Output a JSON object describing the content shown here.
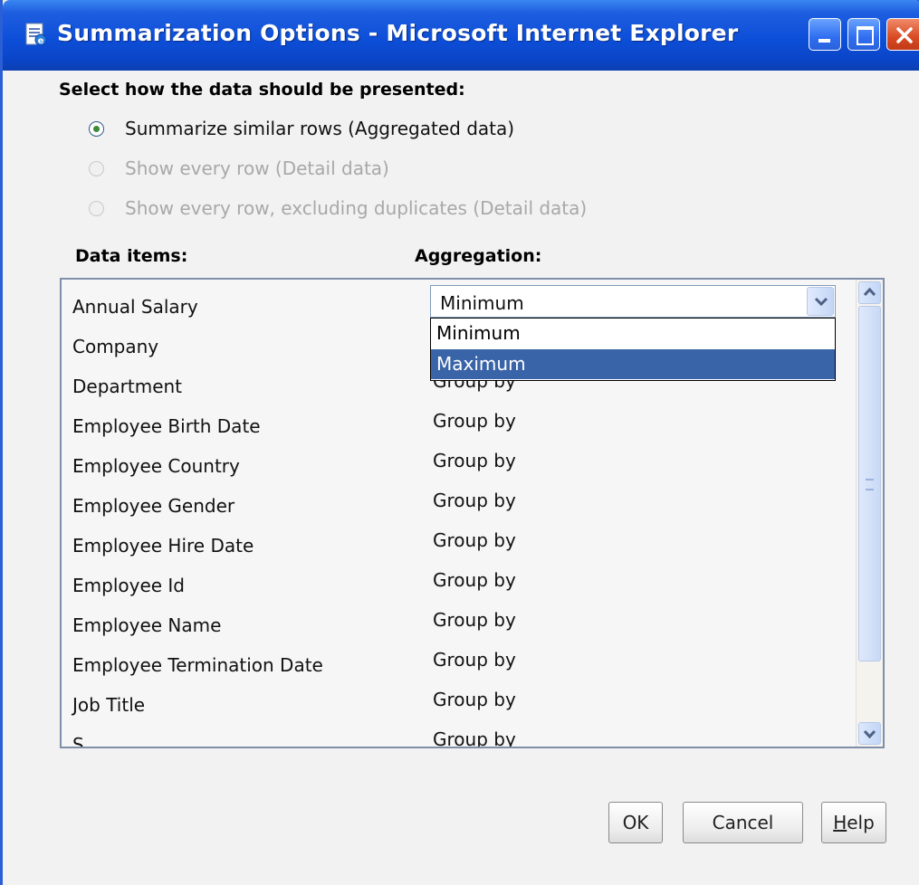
{
  "window": {
    "title": "Summarization Options - Microsoft Internet Explorer",
    "icon": "ie-page-icon",
    "controls": [
      "minimize-icon",
      "maximize-icon",
      "close-icon"
    ]
  },
  "presentation": {
    "heading": "Select how the data should be presented:",
    "options": [
      {
        "label": "Summarize similar rows (Aggregated data)",
        "selected": true,
        "enabled": true
      },
      {
        "label": "Show every row (Detail data)",
        "selected": false,
        "enabled": false
      },
      {
        "label": "Show every row, excluding duplicates (Detail data)",
        "selected": false,
        "enabled": false
      }
    ]
  },
  "columns": {
    "items_header": "Data items:",
    "aggregation_header": "Aggregation:"
  },
  "rows": [
    {
      "item": "Annual Salary",
      "aggregation": "Minimum"
    },
    {
      "item": "Company",
      "aggregation": ""
    },
    {
      "item": "Department",
      "aggregation": "Group by"
    },
    {
      "item": "Employee Birth Date",
      "aggregation": "Group by"
    },
    {
      "item": "Employee Country",
      "aggregation": "Group by"
    },
    {
      "item": "Employee Gender",
      "aggregation": "Group by"
    },
    {
      "item": "Employee Hire Date",
      "aggregation": "Group by"
    },
    {
      "item": "Employee Id",
      "aggregation": "Group by"
    },
    {
      "item": "Employee Name",
      "aggregation": "Group by"
    },
    {
      "item": "Employee Termination Date",
      "aggregation": "Group by"
    },
    {
      "item": "Job Title",
      "aggregation": "Group by"
    },
    {
      "item": "S",
      "aggregation": "Group by"
    }
  ],
  "combo": {
    "value": "Minimum",
    "options": [
      "Minimum",
      "Maximum"
    ],
    "highlighted": "Maximum"
  },
  "buttons": {
    "ok": "OK",
    "cancel": "Cancel",
    "help_mnemonic": "H",
    "help_rest": "elp"
  },
  "colors": {
    "titlebar": "#0d4fd8",
    "selection": "#3a64a8",
    "radio_dot": "#3a8a3a"
  }
}
